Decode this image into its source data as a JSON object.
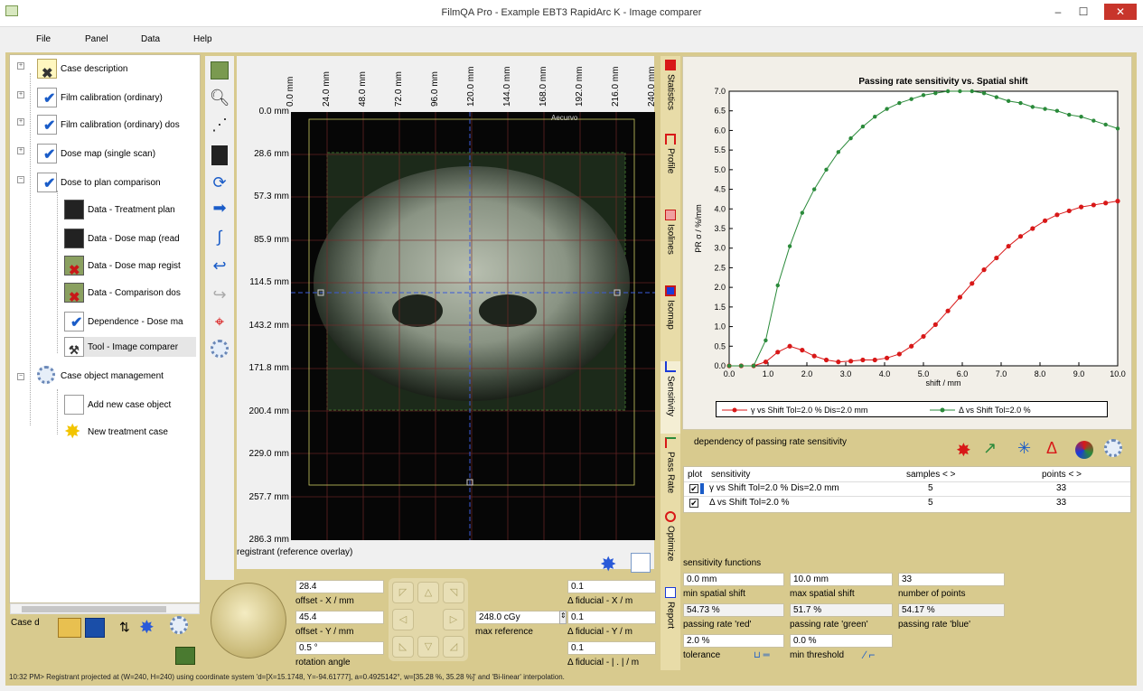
{
  "window": {
    "title": "FilmQA Pro - Example EBT3 RapidArc K - Image comparer",
    "minimize": "–",
    "maximize": "☐",
    "close": "✕"
  },
  "menu": [
    "File",
    "Panel",
    "Data",
    "Help"
  ],
  "tree": {
    "items": [
      {
        "label": "Case description"
      },
      {
        "label": "Film calibration (ordinary)"
      },
      {
        "label": "Film calibration (ordinary) dos"
      },
      {
        "label": "Dose map (single scan)"
      },
      {
        "label": "Dose to plan comparison"
      },
      {
        "label": "Data - Treatment plan"
      },
      {
        "label": "Data - Dose map (read"
      },
      {
        "label": "Data - Dose map regist"
      },
      {
        "label": "Data - Comparison dos"
      },
      {
        "label": "Dependence - Dose ma"
      },
      {
        "label": "Tool - Image comparer"
      },
      {
        "label": "Case object management"
      },
      {
        "label": "Add new case object"
      },
      {
        "label": "New treatment case"
      }
    ],
    "case_label": "Case d"
  },
  "viewer": {
    "y_ticks": [
      "0.0 mm",
      "28.6 mm",
      "57.3 mm",
      "85.9 mm",
      "114.5 mm",
      "143.2 mm",
      "171.8 mm",
      "200.4 mm",
      "229.0 mm",
      "257.7 mm",
      "286.3 mm"
    ],
    "x_ticks": [
      "0.0 mm",
      "24.0 mm",
      "48.0 mm",
      "72.0 mm",
      "96.0 mm",
      "120.0 mm",
      "144.0 mm",
      "168.0 mm",
      "192.0 mm",
      "216.0 mm",
      "240.0 mm"
    ],
    "caption": "registrant (reference overlay)",
    "corner_text": "Aecurvo"
  },
  "controls": {
    "offset_x_value": "28.4",
    "offset_x_label": "offset - X / mm",
    "offset_y_value": "45.4",
    "offset_y_label": "offset - Y / mm",
    "rotation_value": "0.5 °",
    "rotation_label": "rotation angle",
    "max_ref_value": "248.0 cGy",
    "max_ref_label": "max reference",
    "fid_x_value": "0.1",
    "fid_x_label": "Δ fiducial - X / m",
    "fid_y_value": "0.1",
    "fid_y_label": "Δ fiducial - Y / m",
    "fid_l_value": "0.1",
    "fid_l_label": "Δ fiducial - | . | / m"
  },
  "tabs": [
    "Statistics",
    "Profile",
    "Isolines",
    "Isomap",
    "Sensitivity",
    "Pass Rate",
    "Optimize",
    "Report"
  ],
  "chart_data": {
    "type": "line",
    "title": "Passing rate sensitivity vs. Spatial shift",
    "xlabel": "shift / mm",
    "ylabel": "PR σ / %/mm",
    "xlim": [
      0,
      10
    ],
    "ylim": [
      0,
      7
    ],
    "x_ticks": [
      "0.0",
      "1.0",
      "2.0",
      "3.0",
      "4.0",
      "5.0",
      "6.0",
      "7.0",
      "8.0",
      "9.0",
      "10.0"
    ],
    "y_ticks": [
      "0.0",
      "0.5",
      "1.0",
      "1.5",
      "2.0",
      "2.5",
      "3.0",
      "3.5",
      "4.0",
      "4.5",
      "5.0",
      "5.5",
      "6.0",
      "6.5",
      "7.0"
    ],
    "grid": false,
    "legend": "bottom",
    "series": [
      {
        "name": "γ vs Shift Tol=2.0 % Dis=2.0 mm",
        "color": "#d81818",
        "x": [
          0.0,
          0.31,
          0.63,
          0.94,
          1.25,
          1.56,
          1.88,
          2.19,
          2.5,
          2.81,
          3.13,
          3.44,
          3.75,
          4.06,
          4.38,
          4.69,
          5.0,
          5.31,
          5.63,
          5.94,
          6.25,
          6.56,
          6.88,
          7.19,
          7.5,
          7.81,
          8.13,
          8.44,
          8.75,
          9.06,
          9.38,
          9.69,
          10.0
        ],
        "y": [
          0.0,
          0.0,
          0.0,
          0.1,
          0.35,
          0.5,
          0.4,
          0.25,
          0.15,
          0.1,
          0.12,
          0.15,
          0.15,
          0.2,
          0.3,
          0.5,
          0.75,
          1.05,
          1.4,
          1.75,
          2.1,
          2.45,
          2.75,
          3.05,
          3.3,
          3.5,
          3.7,
          3.85,
          3.95,
          4.05,
          4.1,
          4.15,
          4.2
        ]
      },
      {
        "name": "Δ vs Shift Tol=2.0 %",
        "color": "#2a8a3a",
        "x": [
          0.0,
          0.31,
          0.63,
          0.94,
          1.25,
          1.56,
          1.88,
          2.19,
          2.5,
          2.81,
          3.13,
          3.44,
          3.75,
          4.06,
          4.38,
          4.69,
          5.0,
          5.31,
          5.63,
          5.94,
          6.25,
          6.56,
          6.88,
          7.19,
          7.5,
          7.81,
          8.13,
          8.44,
          8.75,
          9.06,
          9.38,
          9.69,
          10.0
        ],
        "y": [
          0.0,
          0.0,
          0.0,
          0.65,
          2.05,
          3.05,
          3.9,
          4.5,
          5.0,
          5.45,
          5.8,
          6.1,
          6.35,
          6.55,
          6.7,
          6.8,
          6.9,
          6.95,
          7.0,
          7.0,
          7.0,
          6.95,
          6.85,
          6.75,
          6.7,
          6.6,
          6.55,
          6.5,
          6.4,
          6.35,
          6.25,
          6.15,
          6.05
        ]
      }
    ]
  },
  "sensitivity": {
    "header": "dependency of passing rate sensitivity",
    "col_plot": "plot",
    "col_sensitivity": "sensitivity",
    "col_samples": "samples < >",
    "col_points": "points < >",
    "rows": [
      {
        "name": "γ vs Shift Tol=2.0 % Dis=2.0 mm",
        "samples": "5",
        "points": "33",
        "check": "✔"
      },
      {
        "name": "Δ vs Shift Tol=2.0 %",
        "samples": "5",
        "points": "33",
        "check": "✔"
      }
    ]
  },
  "functions": {
    "header": "sensitivity functions",
    "min_shift_value": "0.0 mm",
    "min_shift_label": "min spatial shift",
    "max_shift_value": "10.0 mm",
    "max_shift_label": "max spatial shift",
    "num_points_value": "33",
    "num_points_label": "number of points",
    "pr_red_value": "54.73 %",
    "pr_red_label": "passing rate 'red'",
    "pr_green_value": "51.7 %",
    "pr_green_label": "passing rate 'green'",
    "pr_blue_value": "54.17 %",
    "pr_blue_label": "passing rate 'blue'",
    "tolerance_value": "2.0 %",
    "tolerance_label": "tolerance",
    "threshold_value": "0.0 %",
    "threshold_label": "min threshold"
  },
  "status": "10:32 PM> Registrant projected at (W=240, H=240) using coordinate system 'd=[X=15.1748, Y=-94.61777], a=0.4925142°, w=[35.28 %, 35.28 %]' and 'Bi-linear' interpolation."
}
